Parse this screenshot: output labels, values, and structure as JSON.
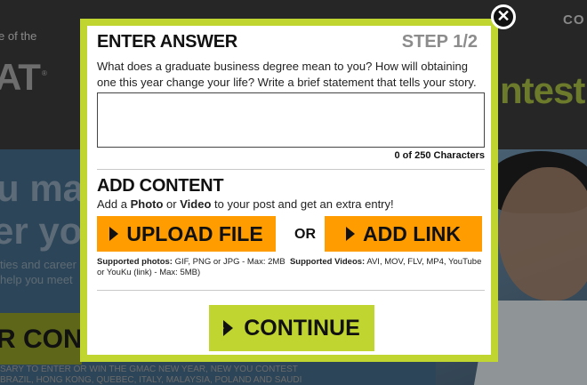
{
  "background": {
    "tagline": "e of the",
    "logo_text": "AT",
    "logo_reg": "®",
    "nav_item": "CO",
    "contest_text": "ntest",
    "hero_line1": "u mak",
    "hero_line2": "er you",
    "hero_small1": "ties and career",
    "hero_small2": "help you meet",
    "enter_text": "R CONT",
    "fine_print1": "SARY TO ENTER OR WIN THE GMAC NEW YEAR, NEW YOU CONTEST",
    "fine_print2": "BRAZIL, HONG KONG, QUEBEC, ITALY, MALAYSIA, POLAND AND SAUDI"
  },
  "modal": {
    "close_glyph": "✕",
    "answer_section": {
      "title": "ENTER ANSWER",
      "step": "STEP 1/2",
      "question": "What does a graduate business degree mean to you? How will obtaining one this year change your life? Write a brief statement that tells your story.",
      "answer_value": "",
      "char_counter": "0 of 250 Characters"
    },
    "content_section": {
      "title": "ADD CONTENT",
      "sub_prefix": "Add a ",
      "sub_photo": "Photo",
      "sub_or": " or ",
      "sub_video": "Video",
      "sub_suffix": " to your post and get an extra entry!",
      "upload_label": "UPLOAD FILE",
      "or_label": "OR",
      "add_link_label": "ADD LINK",
      "supported_photos_label": "Supported photos:",
      "supported_photos_value": " GIF, PNG or JPG - Max: 2MB",
      "supported_videos_label": "Supported Videos:",
      "supported_videos_value": " AVI, MOV, FLV, MP4, YouTube or YouKu (link) - Max: 5MB)"
    },
    "continue_label": "CONTINUE"
  },
  "colors": {
    "accent_green": "#c1d530",
    "button_orange": "#ff9c00",
    "step_gray": "#8c8c8c"
  }
}
